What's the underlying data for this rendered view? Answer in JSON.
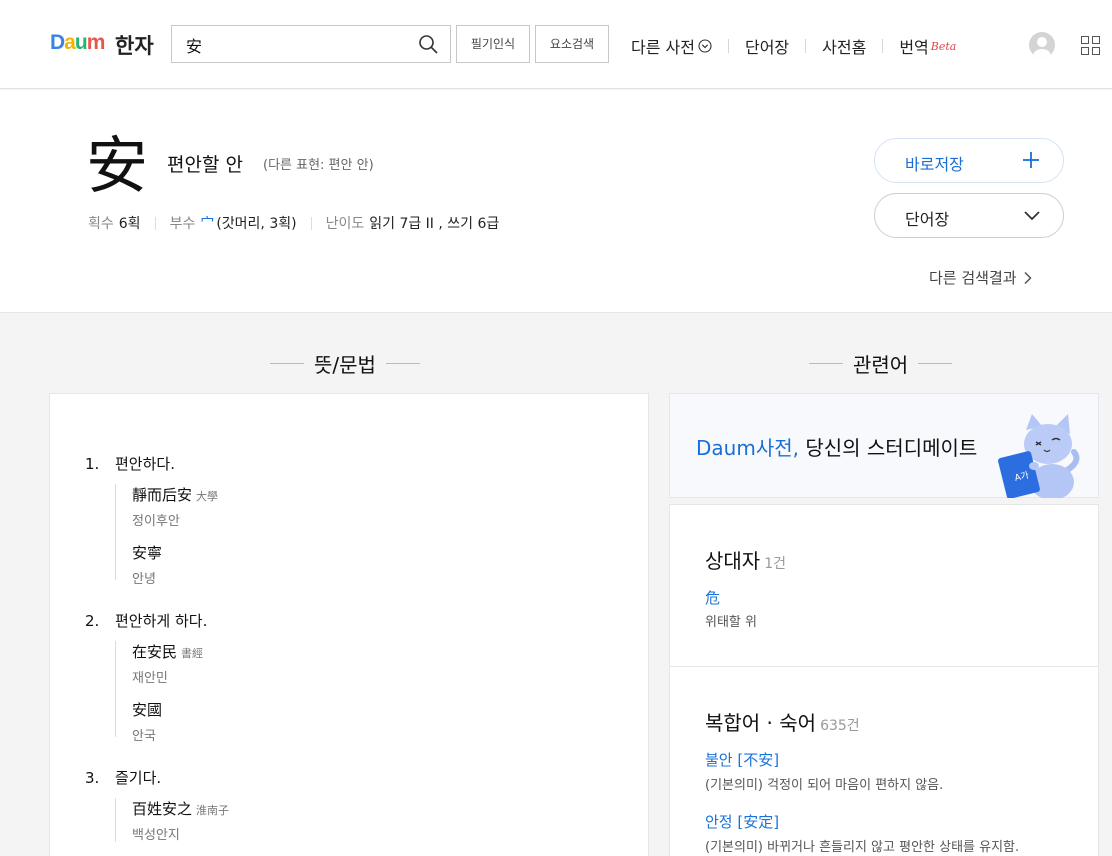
{
  "header": {
    "logo": {
      "d": "D",
      "a": "a",
      "u": "u",
      "m": "m"
    },
    "service_name": "한자",
    "search": {
      "value": "安"
    },
    "buttons": {
      "handwriting": "필기인식",
      "element_search": "요소검색"
    },
    "nav": {
      "other_dict": "다른 사전",
      "vocab": "단어장",
      "dict_home": "사전홈",
      "translate": "번역",
      "beta": "Beta"
    }
  },
  "entry": {
    "hanja": "安",
    "meaning": "편안할 안",
    "alt_expr": "(다른 표현: 편안 안)",
    "strokes_label": "획수",
    "strokes_value": "6획",
    "radical_label": "부수",
    "radical_char": "宀",
    "radical_desc": "(갓머리, 3획)",
    "difficulty_label": "난이도",
    "difficulty_value": "읽기 7급 II , 쓰기 6급",
    "save_button": "바로저장",
    "vocab_button": "단어장",
    "other_results": "다른 검색결과"
  },
  "sections": {
    "meaning_title": "뜻/문법",
    "related_title": "관련어"
  },
  "meanings": [
    {
      "num": "1.",
      "text": "편안하다.",
      "examples": [
        {
          "han": "靜而后安",
          "src": "大學",
          "read": "정이후안"
        },
        {
          "han": "安寧",
          "src": "",
          "read": "안녕"
        }
      ]
    },
    {
      "num": "2.",
      "text": "편안하게 하다.",
      "examples": [
        {
          "han": "在安民",
          "src": "書經",
          "read": "재안민"
        },
        {
          "han": "安國",
          "src": "",
          "read": "안국"
        }
      ]
    },
    {
      "num": "3.",
      "text": "즐기다.",
      "examples": [
        {
          "han": "百姓安之",
          "src": "淮南子",
          "read": "백성안지"
        }
      ]
    }
  ],
  "banner": {
    "brand": "Daum사전,",
    "text": " 당신의 스터디메이트"
  },
  "related": {
    "antonym": {
      "title": "상대자",
      "count": "1건",
      "word": "危",
      "desc": "위태할 위"
    },
    "compound": {
      "title": "복합어 · 숙어",
      "count": "635건",
      "items": [
        {
          "word": "불안 [不安]",
          "desc": "(기본의미) 걱정이 되어 마음이 편하지 않음."
        },
        {
          "word": "안정 [安定]",
          "desc": "(기본의미) 바뀌거나 흔들리지 않고 평안한 상태를 유지함."
        }
      ]
    }
  },
  "colors": {
    "accent": "#1a6fd6",
    "link": "#1a73d9",
    "beta": "#e34747"
  }
}
